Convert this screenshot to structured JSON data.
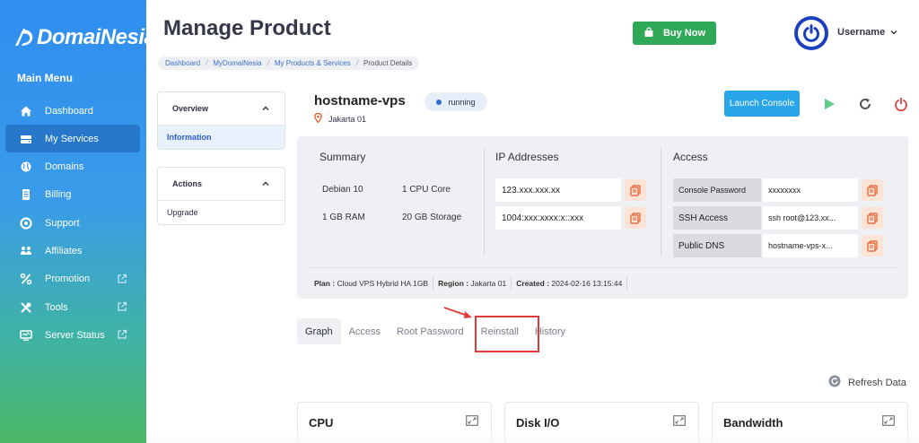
{
  "brand": {
    "logo_text": "DomaiNesia"
  },
  "sidebar": {
    "title": "Main Menu",
    "items": [
      {
        "label": "Dashboard",
        "icon": "home-icon",
        "external": false,
        "active": false
      },
      {
        "label": "My Services",
        "icon": "server-icon",
        "external": false,
        "active": true
      },
      {
        "label": "Domains",
        "icon": "globe-icon",
        "external": false,
        "active": false
      },
      {
        "label": "Billing",
        "icon": "billing-icon",
        "external": false,
        "active": false
      },
      {
        "label": "Support",
        "icon": "support-icon",
        "external": false,
        "active": false
      },
      {
        "label": "Affiliates",
        "icon": "affiliates-icon",
        "external": false,
        "active": false
      },
      {
        "label": "Promotion",
        "icon": "percent-icon",
        "external": true,
        "active": false
      },
      {
        "label": "Tools",
        "icon": "tools-icon",
        "external": true,
        "active": false
      },
      {
        "label": "Server Status",
        "icon": "monitor-icon",
        "external": true,
        "active": false
      }
    ]
  },
  "header": {
    "title": "Manage Product",
    "buy_label": "Buy Now",
    "username": "Username"
  },
  "breadcrumb": [
    "Dashboard",
    "MyDomaiNesia",
    "My Products & Services",
    "Product Details"
  ],
  "left_panels": {
    "overview": {
      "title": "Overview",
      "items": [
        "Information"
      ]
    },
    "actions": {
      "title": "Actions",
      "items": [
        "Upgrade"
      ]
    }
  },
  "server": {
    "hostname": "hostname-vps",
    "status": "running",
    "location": "Jakarta 01",
    "launch_label": "Launch Console"
  },
  "summary": {
    "title": "Summary",
    "os": "Debian 10",
    "cpu": "1 CPU Core",
    "ram": "1 GB RAM",
    "storage": "20 GB Storage"
  },
  "ip": {
    "title": "IP Addresses",
    "ipv4": "123.xxx.xxx.xx",
    "ipv6": "1004:xxx:xxxx:x::xxx"
  },
  "access": {
    "title": "Access",
    "rows": [
      {
        "label": "Console Password",
        "value": "xxxxxxxx"
      },
      {
        "label": "SSH Access",
        "value": "ssh root@123.xx..."
      },
      {
        "label": "Public DNS",
        "value": "hostname-vps-x..."
      }
    ]
  },
  "footer": {
    "plan_label": "Plan :",
    "plan": "Cloud VPS Hybrid HA 1GB",
    "region_label": "Region :",
    "region": "Jakarta 01",
    "created_label": "Created :",
    "created": "2024-02-16 13:15:44"
  },
  "tabs": [
    "Graph",
    "Access",
    "Root Password",
    "Reinstall",
    "History"
  ],
  "active_tab": "Graph",
  "highlighted_tab": "Reinstall",
  "refresh_label": "Refresh Data",
  "cards": [
    "CPU",
    "Disk I/O",
    "Bandwidth"
  ],
  "colors": {
    "accent": "#29a5ea",
    "buy": "#2fa957",
    "highlight": "#e23a3a",
    "power": "#e0413f",
    "play": "#5fc98a"
  }
}
